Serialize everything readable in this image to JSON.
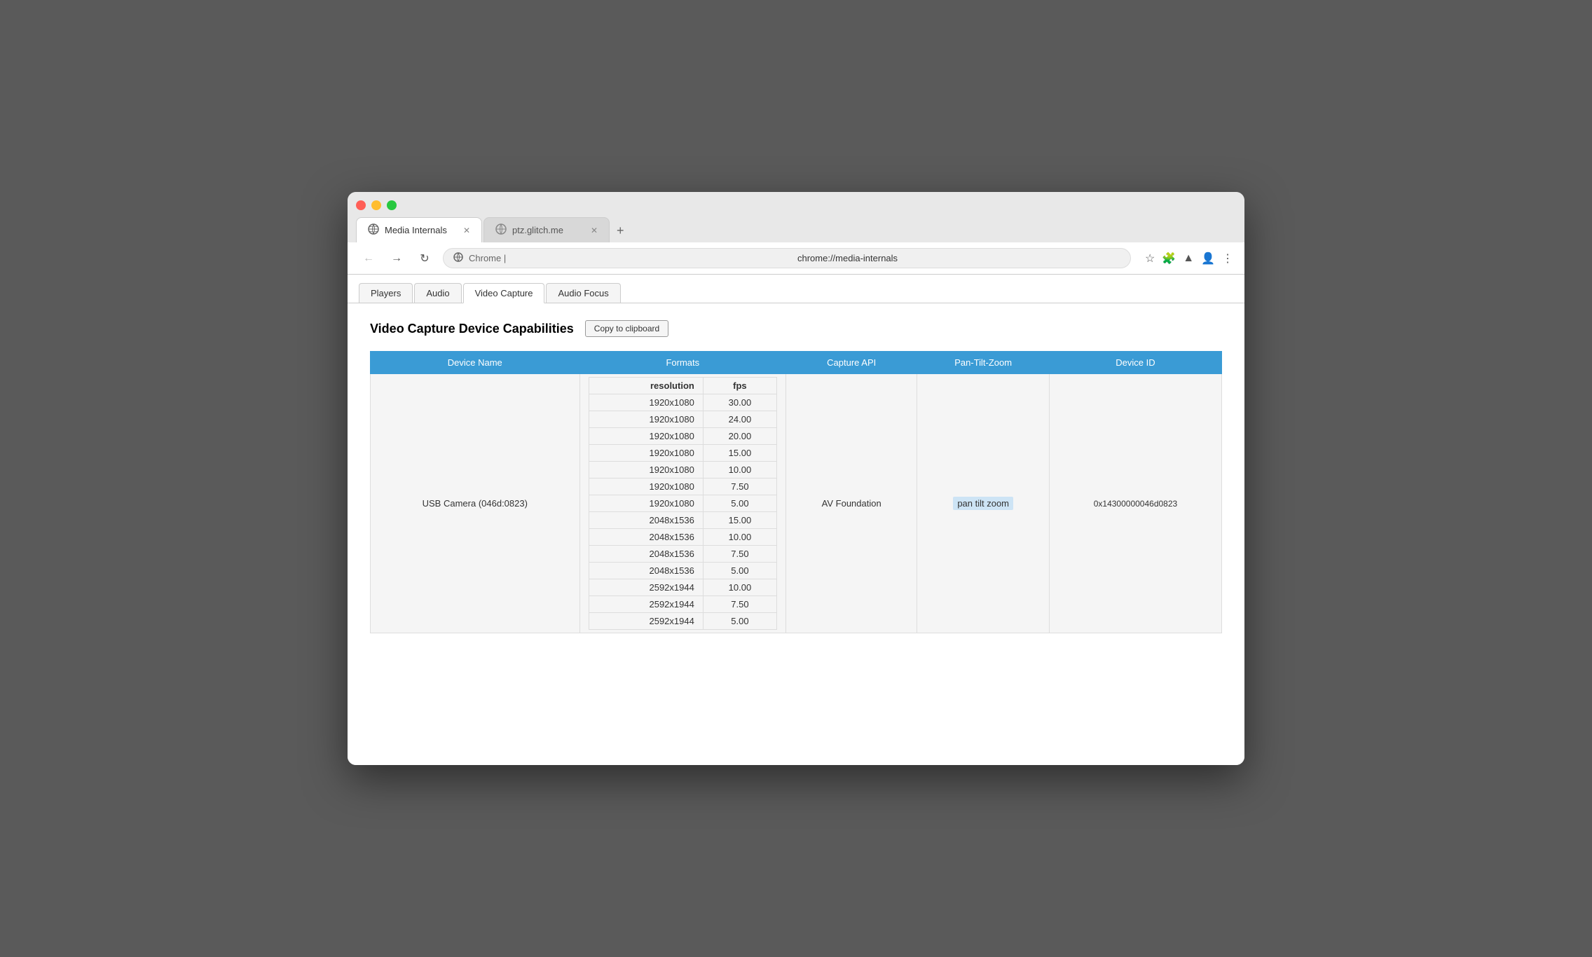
{
  "browser": {
    "traffic_lights": [
      "red",
      "yellow",
      "green"
    ],
    "tabs": [
      {
        "id": "media-internals",
        "label": "Media Internals",
        "url": "chrome://media-internals",
        "active": true,
        "icon": "globe"
      },
      {
        "id": "ptz-glitch",
        "label": "ptz.glitch.me",
        "url": "ptz.glitch.me",
        "active": false,
        "icon": "globe"
      }
    ],
    "address_bar": {
      "prefix": "Chrome | ",
      "url": "chrome://media-internals"
    },
    "new_tab_label": "+"
  },
  "page_nav": {
    "tabs": [
      {
        "id": "players",
        "label": "Players",
        "active": false
      },
      {
        "id": "audio",
        "label": "Audio",
        "active": false
      },
      {
        "id": "video-capture",
        "label": "Video Capture",
        "active": true
      },
      {
        "id": "audio-focus",
        "label": "Audio Focus",
        "active": false
      }
    ]
  },
  "section": {
    "title": "Video Capture Device Capabilities",
    "copy_button": "Copy to clipboard"
  },
  "table": {
    "headers": [
      "Device Name",
      "Formats",
      "Capture API",
      "Pan-Tilt-Zoom",
      "Device ID"
    ],
    "formats_sub_headers": [
      "resolution",
      "fps"
    ],
    "rows": [
      {
        "device_name": "USB Camera (046d:0823)",
        "formats": [
          {
            "resolution": "1920x1080",
            "fps": "30.00"
          },
          {
            "resolution": "1920x1080",
            "fps": "24.00"
          },
          {
            "resolution": "1920x1080",
            "fps": "20.00"
          },
          {
            "resolution": "1920x1080",
            "fps": "15.00"
          },
          {
            "resolution": "1920x1080",
            "fps": "10.00"
          },
          {
            "resolution": "1920x1080",
            "fps": "7.50"
          },
          {
            "resolution": "1920x1080",
            "fps": "5.00"
          },
          {
            "resolution": "2048x1536",
            "fps": "15.00"
          },
          {
            "resolution": "2048x1536",
            "fps": "10.00"
          },
          {
            "resolution": "2048x1536",
            "fps": "7.50"
          },
          {
            "resolution": "2048x1536",
            "fps": "5.00"
          },
          {
            "resolution": "2592x1944",
            "fps": "10.00"
          },
          {
            "resolution": "2592x1944",
            "fps": "7.50"
          },
          {
            "resolution": "2592x1944",
            "fps": "5.00"
          }
        ],
        "capture_api": "AV Foundation",
        "ptz": "pan tilt zoom",
        "device_id": "0x14300000046d0823"
      }
    ]
  },
  "colors": {
    "table_header_bg": "#3a9bd5",
    "table_header_text": "#ffffff",
    "ptz_highlight_bg": "#cde4f5"
  }
}
